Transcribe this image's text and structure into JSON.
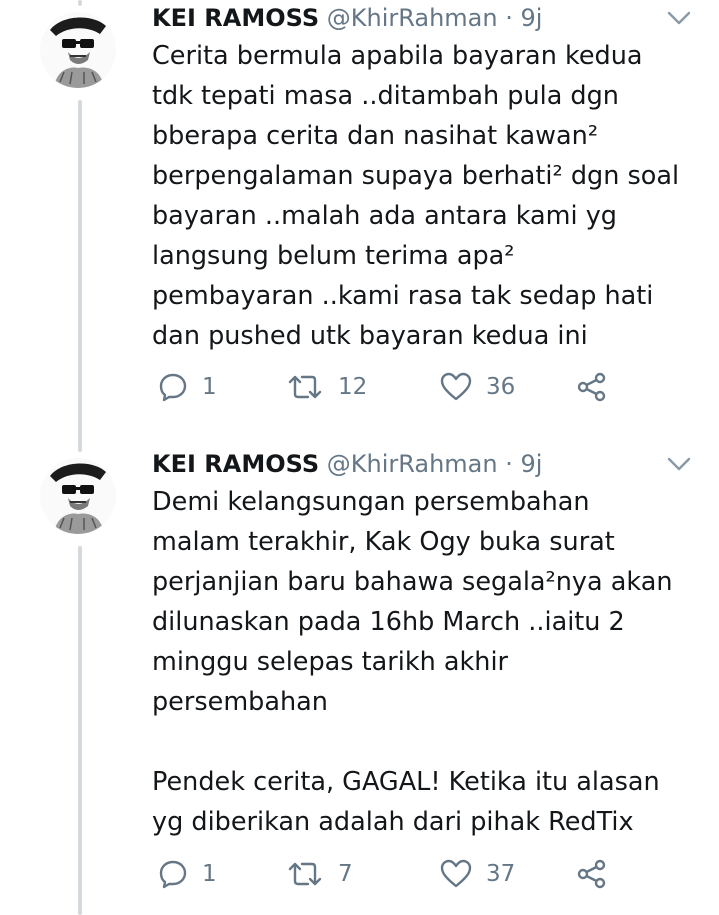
{
  "tweets": [
    {
      "name": "KEI RAMOSS",
      "handle": "@KhirRahman",
      "separator": "·",
      "time": "9j",
      "text": "Cerita bermula apabila bayaran kedua\ntdk tepati masa ..ditambah pula dgn\nbberapa cerita dan nasihat kawan²\nberpengalaman supaya berhati² dgn soal\nbayaran ..malah ada antara kami yg\nlangsung belum terima apa²\npembayaran ..kami rasa tak sedap hati\ndan pushed utk bayaran kedua ini",
      "replies": "1",
      "retweets": "12",
      "likes": "36"
    },
    {
      "name": "KEI RAMOSS",
      "handle": "@KhirRahman",
      "separator": "·",
      "time": "9j",
      "text": "Demi kelangsungan persembahan\nmalam terakhir, Kak Ogy buka surat\nperjanjian baru bahawa segala²nya akan\ndilunaskan pada 16hb March ..iaitu 2\nminggu selepas tarikh akhir\npersembahan\n\nPendek cerita, GAGAL! Ketika itu alasan\nyg diberikan adalah dari pihak RedTix",
      "replies": "1",
      "retweets": "7",
      "likes": "37"
    }
  ],
  "icons": {
    "avatar": "avatar-icon",
    "caret": "chevron-down-icon",
    "reply": "reply-icon",
    "retweet": "retweet-icon",
    "like": "heart-icon",
    "share": "share-icon"
  },
  "colors": {
    "text": "#14171a",
    "muted": "#657786",
    "thread_line": "#d4d9de"
  }
}
